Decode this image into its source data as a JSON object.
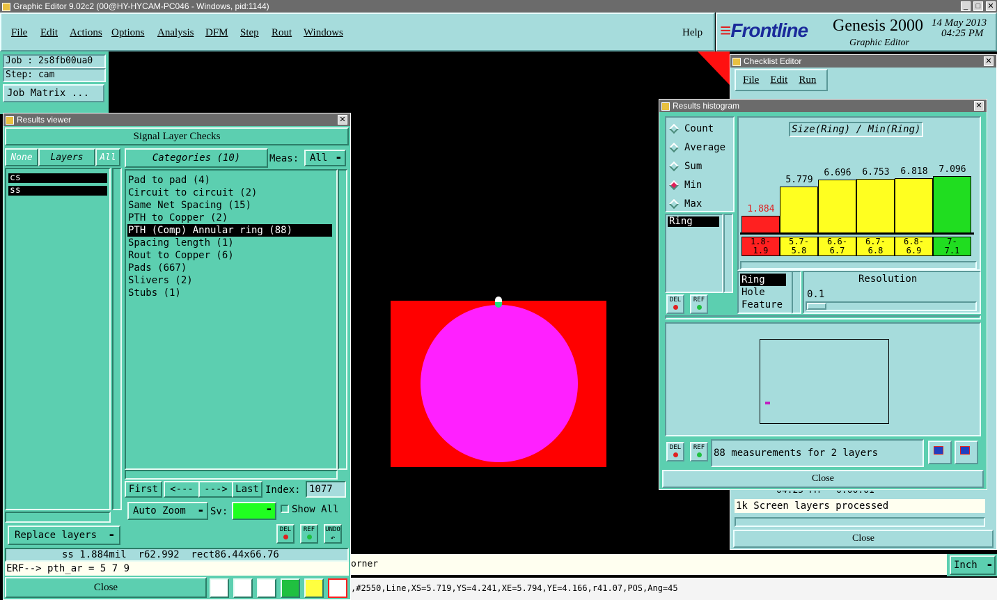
{
  "app": {
    "title": "Graphic Editor 9.02c2 (00@HY-HYCAM-PC046 - Windows, pid:1144)"
  },
  "menu": {
    "items": [
      "File",
      "Edit",
      "Actions",
      "Options",
      "Analysis",
      "DFM",
      "Step",
      "Rout",
      "Windows"
    ],
    "help": "Help"
  },
  "brand": {
    "logo": "Frontline",
    "product": "Genesis 2000",
    "subtitle": "Graphic Editor",
    "date": "14 May 2013",
    "time": "04:25 PM"
  },
  "job": {
    "job_label": "Job : 2s8fb00ua0",
    "step_label": "Step: cam",
    "matrix_button": "Job Matrix ..."
  },
  "results_viewer": {
    "title": "Results viewer",
    "header": "Signal Layer Checks",
    "none_btn": "None",
    "layers_btn": "Layers",
    "all_btn": "All",
    "layers": [
      "cs",
      "ss"
    ],
    "categories_btn": "Categories (10)",
    "meas_label": "Meas:",
    "meas_value": "All",
    "categories": [
      "Pad to pad (4)",
      "Circuit to circuit (2)",
      "Same Net Spacing (15)",
      "PTH to Copper (2)",
      "PTH (Comp) Annular ring (88)",
      "Spacing length (1)",
      "Rout to Copper (6)",
      "Pads (667)",
      "Slivers (2)",
      "Stubs (1)"
    ],
    "selected_category_index": 4,
    "first_btn": "First",
    "prev_btn": "<---",
    "next_btn": "--->",
    "last_btn": "Last",
    "index_label": "Index:",
    "index_value": "1077",
    "auto_zoom": "Auto Zoom",
    "sv_label": "Sv:",
    "show_all": "Show All",
    "replace_layers": "Replace layers",
    "del": "DEL",
    "ref": "REF",
    "undo": "UNDO",
    "status_line": "ss 1.884mil  r62.992  rect86.44x66.76",
    "erf_line": "ERF--> pth_ar = 5 7 9",
    "close": "Close"
  },
  "checklist": {
    "title": "Checklist Editor",
    "menu": [
      "File",
      "Edit",
      "Run"
    ],
    "log_line1": "04:25 PM - 0:00:01",
    "log_line2": "1k Screen layers processed",
    "close": "Close"
  },
  "histogram": {
    "title": "Results histogram",
    "modes": [
      "Count",
      "Average",
      "Sum",
      "Min",
      "Max"
    ],
    "selected_mode": "Min",
    "chart_title": "Size(Ring) / Min(Ring)",
    "list_item": "Ring",
    "attr_items": [
      "Ring",
      "Hole",
      "Feature"
    ],
    "resolution_label": "Resolution",
    "resolution_value": "0.1",
    "measurements": "88 measurements for 2 layers",
    "del": "DEL",
    "ref": "REF",
    "close": "Close"
  },
  "chart_data": {
    "type": "bar",
    "title": "Size(Ring) / Min(Ring)",
    "categories": [
      "1.8-1.9",
      "5.7-5.8",
      "6.6-6.7",
      "6.7-6.8",
      "6.8-6.9",
      "7-7.1"
    ],
    "values": [
      1.884,
      5.779,
      6.696,
      6.753,
      6.818,
      7.096
    ],
    "value_labels": [
      "1.884",
      "5.779",
      "6.696",
      "6.753",
      "6.818",
      "7.096"
    ],
    "bin_labels": [
      [
        "1.8-",
        "1.9"
      ],
      [
        "5.7-",
        "5.8"
      ],
      [
        "6.6-",
        "6.7"
      ],
      [
        "6.7-",
        "6.8"
      ],
      [
        "6.8-",
        "6.9"
      ],
      [
        "7-",
        "7.1"
      ]
    ],
    "colors": [
      "#ff2020",
      "#ffff20",
      "#ffff20",
      "#ffff20",
      "#ffff20",
      "#20dd20"
    ],
    "ylim": [
      0,
      7.5
    ]
  },
  "bottom": {
    "prompt_fragment": "orner",
    "units": "Inch",
    "coords_line": ",#2550,Line,XS=5.719,YS=4.241,XE=5.794,YE=4.166,r41.07,POS,Ang=45"
  },
  "colors": {
    "teal": "#5ccfb0",
    "cyan": "#a6dcdc",
    "copper_red": "#ff0000",
    "pad_magenta": "#ff20ff"
  }
}
